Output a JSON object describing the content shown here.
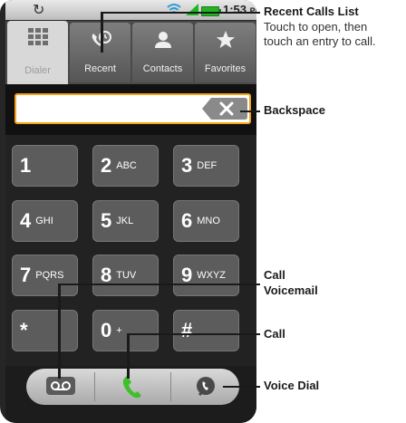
{
  "status_bar": {
    "sync_icon": "sync-icon",
    "time": "1:53",
    "ampm": "PM",
    "battery_color": "#22b522"
  },
  "tabs": [
    {
      "label": "Dialer",
      "icon": "keypad-icon",
      "active": true
    },
    {
      "label": "Recent",
      "icon": "recent-calls-icon",
      "active": false
    },
    {
      "label": "Contacts",
      "icon": "person-icon",
      "active": false
    },
    {
      "label": "Favorites",
      "icon": "star-icon",
      "active": false
    }
  ],
  "number_field": {
    "value": "",
    "placeholder": ""
  },
  "keys": [
    {
      "digit": "1",
      "letters": ""
    },
    {
      "digit": "2",
      "letters": "ABC"
    },
    {
      "digit": "3",
      "letters": "DEF"
    },
    {
      "digit": "4",
      "letters": "GHI"
    },
    {
      "digit": "5",
      "letters": "JKL"
    },
    {
      "digit": "6",
      "letters": "MNO"
    },
    {
      "digit": "7",
      "letters": "PQRS"
    },
    {
      "digit": "8",
      "letters": "TUV"
    },
    {
      "digit": "9",
      "letters": "WXYZ"
    },
    {
      "digit": "*",
      "letters": ""
    },
    {
      "digit": "0",
      "letters": "+"
    },
    {
      "digit": "#",
      "letters": ""
    }
  ],
  "bottom_bar": {
    "voicemail_icon": "voicemail-icon",
    "call_icon": "phone-handset-icon",
    "voice_dial_icon": "voice-dial-icon",
    "call_color": "#3fbf2a"
  },
  "callouts": {
    "recent": {
      "title": "Recent Calls List",
      "line1": "Touch to open, then",
      "line2": "touch an entry to call."
    },
    "backspace": {
      "title": "Backspace"
    },
    "voicemail": {
      "line1": "Call",
      "line2": "Voicemail"
    },
    "call": {
      "title": "Call"
    },
    "voice_dial": {
      "title": "Voice Dial"
    }
  }
}
